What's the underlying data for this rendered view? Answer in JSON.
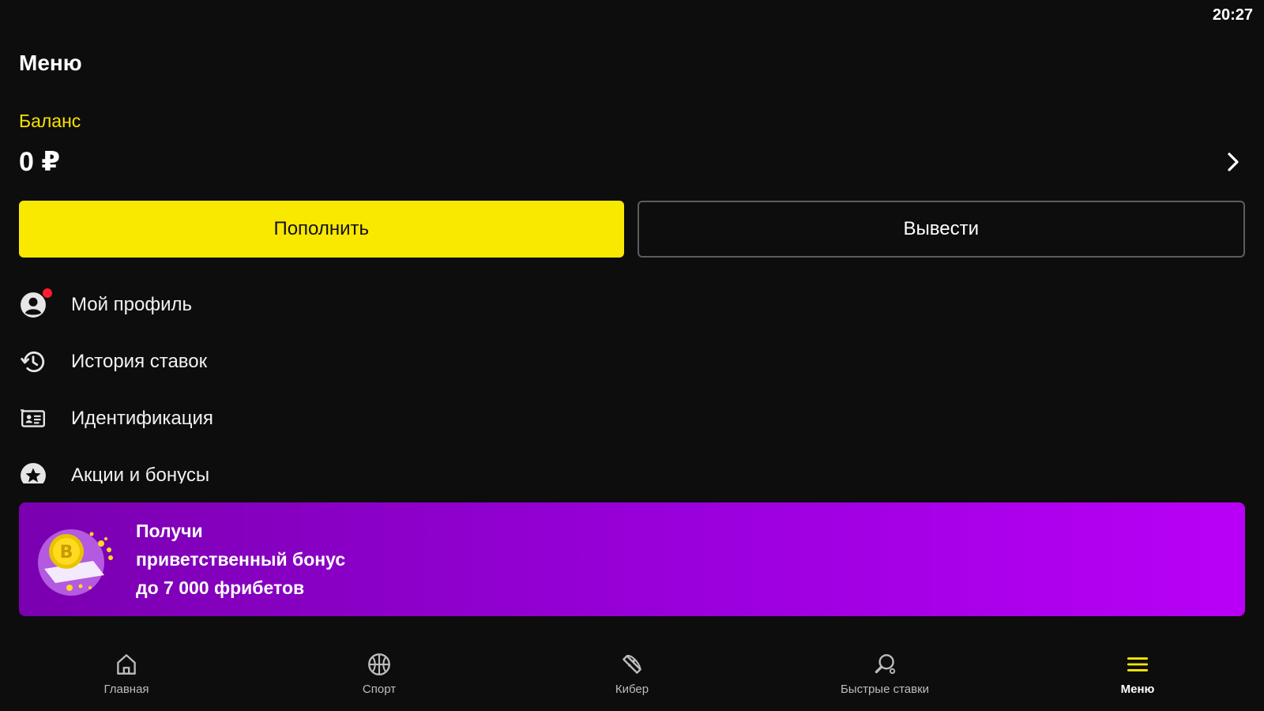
{
  "status": {
    "time": "20:27"
  },
  "page": {
    "title": "Меню"
  },
  "balance": {
    "label": "Баланс",
    "amount": "0 ₽"
  },
  "actions": {
    "deposit": "Пополнить",
    "withdraw": "Вывести"
  },
  "menu": {
    "items": [
      {
        "label": "Мой профиль",
        "icon": "profile-icon",
        "has_notification": true
      },
      {
        "label": "История ставок",
        "icon": "history-icon"
      },
      {
        "label": "Идентификация",
        "icon": "id-card-icon"
      },
      {
        "label": "Акции и бонусы",
        "icon": "star-badge-icon"
      }
    ]
  },
  "promo": {
    "line1": "Получи",
    "line2": "приветственный бонус",
    "line3": "до 7 000 фрибетов",
    "colors": {
      "start": "#7a00b0",
      "end": "#b900f7"
    }
  },
  "bottom_nav": {
    "items": [
      {
        "label": "Главная",
        "icon": "home-icon"
      },
      {
        "label": "Спорт",
        "icon": "ball-icon"
      },
      {
        "label": "Кибер",
        "icon": "gamepad-icon"
      },
      {
        "label": "Быстрые ставки",
        "icon": "ping-pong-icon"
      },
      {
        "label": "Меню",
        "icon": "menu-icon",
        "active": true
      }
    ]
  },
  "colors": {
    "accent": "#f9e800",
    "background": "#0d0d0d",
    "notification": "#ff1c2c"
  }
}
